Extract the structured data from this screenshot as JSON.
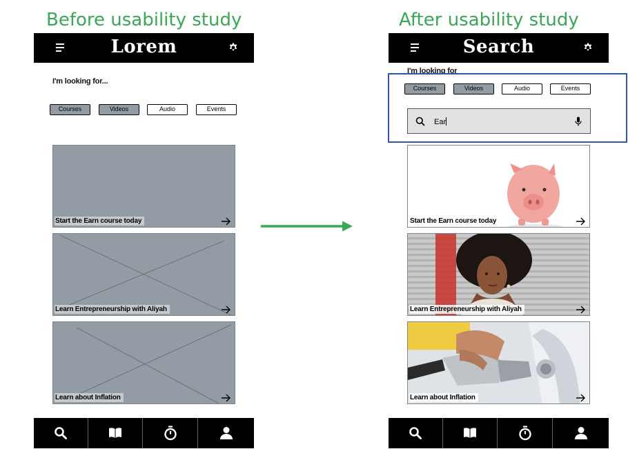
{
  "before": {
    "section_title": "Before usability study",
    "app_title": "Lorem",
    "prompt": "I'm looking for...",
    "chips": [
      {
        "label": "Courses",
        "selected": true
      },
      {
        "label": "Videos",
        "selected": true
      },
      {
        "label": "Audio",
        "selected": false
      },
      {
        "label": "Events",
        "selected": false
      }
    ],
    "cards": [
      {
        "label": "Start the Earn course today"
      },
      {
        "label": "Learn Entrepreneurship with Aliyah"
      },
      {
        "label": "Learn about Inflation"
      }
    ]
  },
  "after": {
    "section_title": "After usability study",
    "app_title": "Search",
    "prompt": "I'm looking for",
    "chips": [
      {
        "label": "Courses",
        "selected": true
      },
      {
        "label": "Videos",
        "selected": true
      },
      {
        "label": "Audio",
        "selected": false
      },
      {
        "label": "Events",
        "selected": false
      }
    ],
    "search_value": "Ear",
    "cards": [
      {
        "label": "Start the Earn course today",
        "image": "piggy-bank-photo"
      },
      {
        "label": "Learn Entrepreneurship with Aliyah",
        "image": "woman-portrait-photo"
      },
      {
        "label": "Learn about Inflation",
        "image": "fuel-pump-photo"
      }
    ]
  },
  "nav_icons": [
    "search-icon",
    "book-icon",
    "timer-icon",
    "profile-icon"
  ],
  "colors": {
    "section_title": "#3aa757",
    "transition_arrow": "#3aa757",
    "highlight_border": "#2f56a8",
    "bar_background": "#000000",
    "placeholder_gray": "#939ca4"
  }
}
